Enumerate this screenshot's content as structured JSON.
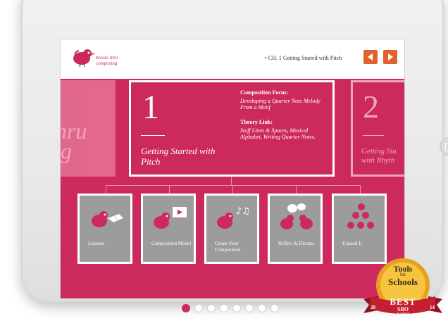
{
  "header": {
    "logo_text": "breeze thru composing",
    "chapter_label": "• CH. 1 Getting Started with Pitch",
    "prev_icon": "triangle-left-icon",
    "next_icon": "triangle-right-icon"
  },
  "chapters": {
    "previous": {
      "text": "thru",
      "text2": "ng"
    },
    "current": {
      "number": "1",
      "title": "Getting Started with Pitch",
      "focus_heading": "Composition Focus:",
      "focus_body": "Developing a Quarter Note Melody From a Motif",
      "theory_heading": "Theory Link:",
      "theory_body": "Staff Lines & Spaces, Musical Alphabet, Writing Quarter Notes."
    },
    "next": {
      "number": "2",
      "title": "Getting Sta",
      "title2": "with Rhyth"
    }
  },
  "tiles": [
    {
      "label": "Lessons",
      "icon": "bird-book-icon"
    },
    {
      "label": "Composition Model",
      "icon": "bird-video-icon"
    },
    {
      "label": "Create Your Composition",
      "icon": "bird-music-notes-icon"
    },
    {
      "label": "Reflect & Discuss",
      "icon": "birds-speech-bubbles-icon"
    },
    {
      "label": "Expand It",
      "icon": "bird-flock-icon"
    }
  ],
  "pager": {
    "active_index": 0,
    "count": 8
  },
  "badge": {
    "line1": "Tools",
    "line2": "for",
    "line3": "Schools",
    "line4": "BEST",
    "year_left": "20",
    "year_right": "14",
    "sbo": "SBO",
    "namm": "NAMM"
  },
  "colors": {
    "brand_pink": "#cc2a5c",
    "nav_orange": "#e2622d",
    "tile_gray": "#9c9c9c",
    "badge_gold": "#e8a11f",
    "badge_red": "#c21f2f"
  }
}
